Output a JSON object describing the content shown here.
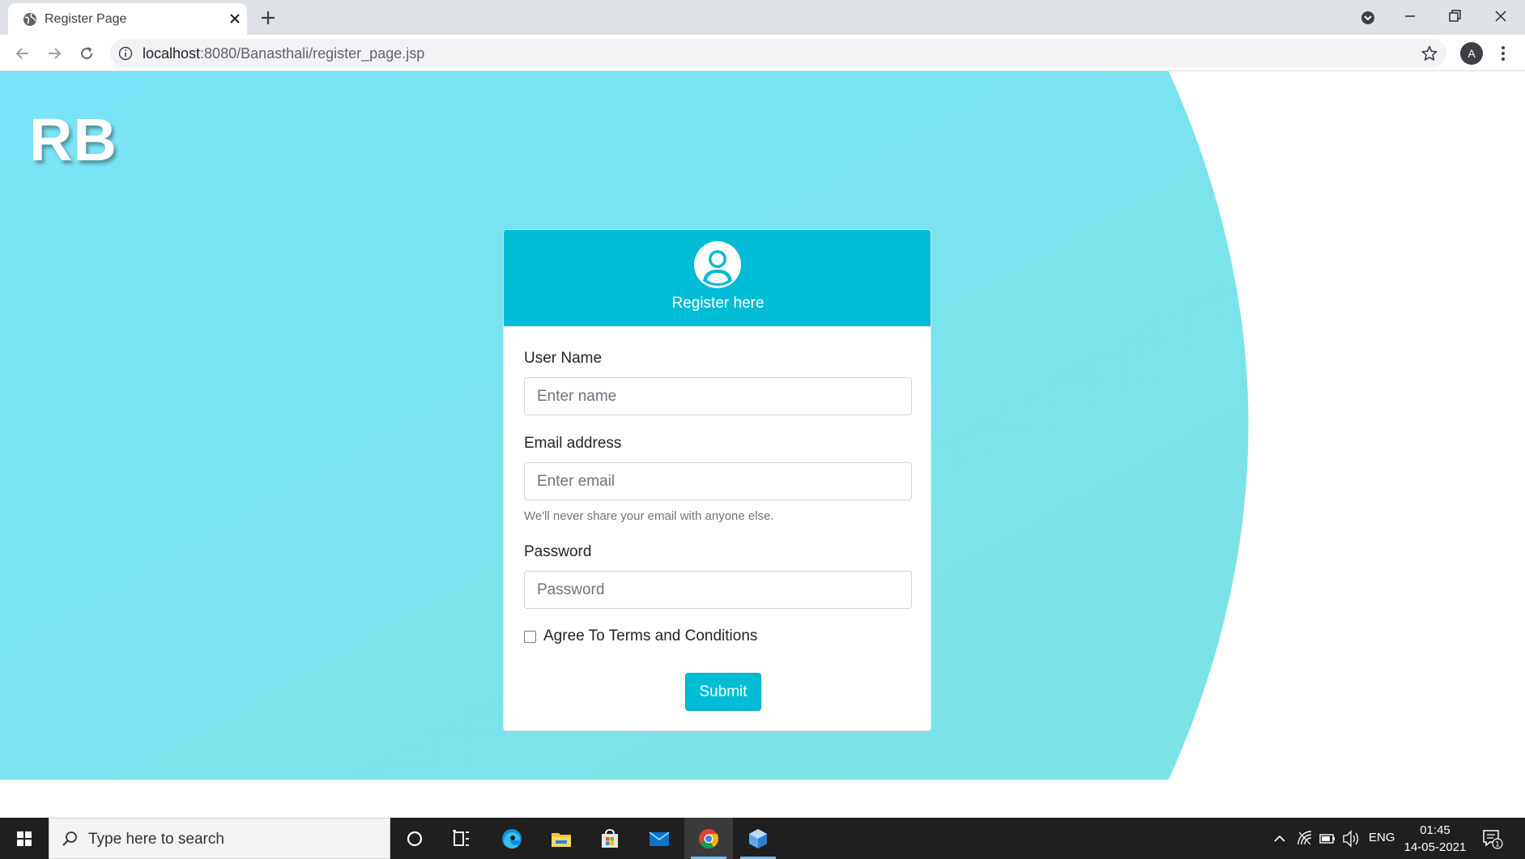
{
  "browser": {
    "tab_title": "Register Page",
    "url_host": "localhost",
    "url_rest": ":8080/Banasthali/register_page.jsp",
    "profile_initial": "A"
  },
  "page": {
    "logo_text": "RB",
    "colors": {
      "background_gradient_start": "#7ae3f8",
      "background_gradient_end": "#7be3e3",
      "accent": "#00bcd4"
    },
    "form": {
      "heading": "Register here",
      "username_label": "User Name",
      "username_placeholder": "Enter name",
      "email_label": "Email address",
      "email_placeholder": "Enter email",
      "email_help": "We'll never share your email with anyone else.",
      "password_label": "Password",
      "password_placeholder": "Password",
      "terms_label": "Agree To Terms and Conditions",
      "terms_checked": false,
      "submit_label": "Submit"
    }
  },
  "taskbar": {
    "search_placeholder": "Type here to search",
    "language": "ENG",
    "time": "01:45",
    "date": "14-05-2021",
    "notification_count": "1",
    "pinned_apps": [
      "cortana-icon",
      "task-view-icon",
      "edge-icon",
      "file-explorer-icon",
      "store-icon",
      "mail-icon",
      "chrome-icon",
      "3d-viewer-icon"
    ]
  }
}
